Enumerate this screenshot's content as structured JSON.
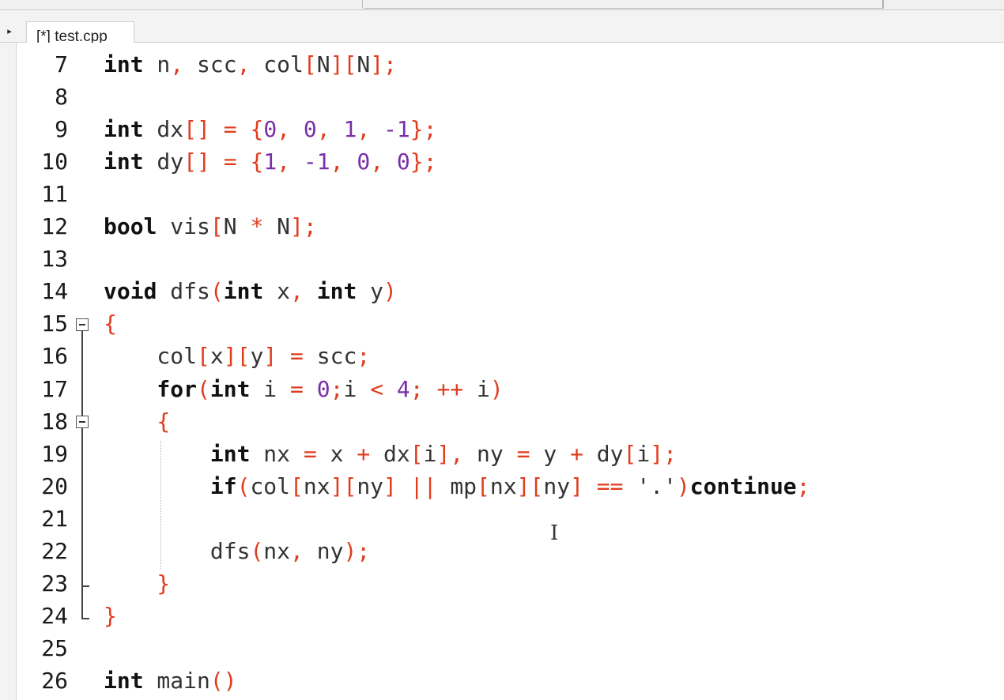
{
  "tab": {
    "label": "[*] test.cpp"
  },
  "lines": [
    {
      "num": "7",
      "tokens": [
        [
          "kw",
          "int"
        ],
        [
          "id",
          " n"
        ],
        [
          "pn",
          ","
        ],
        [
          "id",
          " scc"
        ],
        [
          "pn",
          ","
        ],
        [
          "id",
          " col"
        ],
        [
          "pn",
          "["
        ],
        [
          "id",
          "N"
        ],
        [
          "pn",
          "]["
        ],
        [
          "id",
          "N"
        ],
        [
          "pn",
          "];"
        ]
      ]
    },
    {
      "num": "8",
      "tokens": []
    },
    {
      "num": "9",
      "tokens": [
        [
          "kw",
          "int"
        ],
        [
          "id",
          " dx"
        ],
        [
          "pn",
          "[]"
        ],
        [
          "op",
          " = "
        ],
        [
          "pn",
          "{"
        ],
        [
          "num",
          "0"
        ],
        [
          "pn",
          ", "
        ],
        [
          "num",
          "0"
        ],
        [
          "pn",
          ", "
        ],
        [
          "num",
          "1"
        ],
        [
          "pn",
          ", "
        ],
        [
          "num",
          "-1"
        ],
        [
          "pn",
          "};"
        ]
      ]
    },
    {
      "num": "10",
      "tokens": [
        [
          "kw",
          "int"
        ],
        [
          "id",
          " dy"
        ],
        [
          "pn",
          "[]"
        ],
        [
          "op",
          " = "
        ],
        [
          "pn",
          "{"
        ],
        [
          "num",
          "1"
        ],
        [
          "pn",
          ", "
        ],
        [
          "num",
          "-1"
        ],
        [
          "pn",
          ", "
        ],
        [
          "num",
          "0"
        ],
        [
          "pn",
          ", "
        ],
        [
          "num",
          "0"
        ],
        [
          "pn",
          "};"
        ]
      ]
    },
    {
      "num": "11",
      "tokens": []
    },
    {
      "num": "12",
      "tokens": [
        [
          "kw",
          "bool"
        ],
        [
          "id",
          " vis"
        ],
        [
          "pn",
          "["
        ],
        [
          "id",
          "N "
        ],
        [
          "op",
          "*"
        ],
        [
          "id",
          " N"
        ],
        [
          "pn",
          "];"
        ]
      ]
    },
    {
      "num": "13",
      "tokens": []
    },
    {
      "num": "14",
      "tokens": [
        [
          "kw",
          "void"
        ],
        [
          "id",
          " dfs"
        ],
        [
          "pn",
          "("
        ],
        [
          "kw",
          "int"
        ],
        [
          "id",
          " x"
        ],
        [
          "pn",
          ", "
        ],
        [
          "kw",
          "int"
        ],
        [
          "id",
          " y"
        ],
        [
          "pn",
          ")"
        ]
      ]
    },
    {
      "num": "15",
      "tokens": [
        [
          "pn",
          "{"
        ]
      ]
    },
    {
      "num": "16",
      "tokens": [
        [
          "id",
          "    col"
        ],
        [
          "pn",
          "["
        ],
        [
          "id",
          "x"
        ],
        [
          "pn",
          "]["
        ],
        [
          "id",
          "y"
        ],
        [
          "pn",
          "]"
        ],
        [
          "op",
          " = "
        ],
        [
          "id",
          "scc"
        ],
        [
          "pn",
          ";"
        ]
      ]
    },
    {
      "num": "17",
      "tokens": [
        [
          "kw",
          "    for"
        ],
        [
          "pn",
          "("
        ],
        [
          "kw",
          "int"
        ],
        [
          "id",
          " i "
        ],
        [
          "op",
          "="
        ],
        [
          "num",
          " 0"
        ],
        [
          "pn",
          ";"
        ],
        [
          "id",
          "i "
        ],
        [
          "op",
          "<"
        ],
        [
          "num",
          " 4"
        ],
        [
          "pn",
          "; "
        ],
        [
          "op",
          "++"
        ],
        [
          "id",
          " i"
        ],
        [
          "pn",
          ")"
        ]
      ]
    },
    {
      "num": "18",
      "tokens": [
        [
          "pn",
          "    {"
        ]
      ]
    },
    {
      "num": "19",
      "tokens": [
        [
          "kw",
          "        int"
        ],
        [
          "id",
          " nx "
        ],
        [
          "op",
          "="
        ],
        [
          "id",
          " x "
        ],
        [
          "op",
          "+"
        ],
        [
          "id",
          " dx"
        ],
        [
          "pn",
          "["
        ],
        [
          "id",
          "i"
        ],
        [
          "pn",
          "], "
        ],
        [
          "id",
          "ny "
        ],
        [
          "op",
          "="
        ],
        [
          "id",
          " y "
        ],
        [
          "op",
          "+"
        ],
        [
          "id",
          " dy"
        ],
        [
          "pn",
          "["
        ],
        [
          "id",
          "i"
        ],
        [
          "pn",
          "];"
        ]
      ]
    },
    {
      "num": "20",
      "tokens": [
        [
          "kw",
          "        if"
        ],
        [
          "pn",
          "("
        ],
        [
          "id",
          "col"
        ],
        [
          "pn",
          "["
        ],
        [
          "id",
          "nx"
        ],
        [
          "pn",
          "]["
        ],
        [
          "id",
          "ny"
        ],
        [
          "pn",
          "]"
        ],
        [
          "op",
          " || "
        ],
        [
          "id",
          "mp"
        ],
        [
          "pn",
          "["
        ],
        [
          "id",
          "nx"
        ],
        [
          "pn",
          "]["
        ],
        [
          "id",
          "ny"
        ],
        [
          "pn",
          "]"
        ],
        [
          "op",
          " == "
        ],
        [
          "id",
          "'.'"
        ],
        [
          "pn",
          ")"
        ],
        [
          "kw",
          "continue"
        ],
        [
          "pn",
          ";"
        ]
      ]
    },
    {
      "num": "21",
      "tokens": []
    },
    {
      "num": "22",
      "tokens": [
        [
          "id",
          "        dfs"
        ],
        [
          "pn",
          "("
        ],
        [
          "id",
          "nx"
        ],
        [
          "pn",
          ", "
        ],
        [
          "id",
          "ny"
        ],
        [
          "pn",
          ");"
        ]
      ]
    },
    {
      "num": "23",
      "tokens": [
        [
          "pn",
          "    }"
        ]
      ]
    },
    {
      "num": "24",
      "tokens": [
        [
          "pn",
          "}"
        ]
      ]
    },
    {
      "num": "25",
      "tokens": []
    },
    {
      "num": "26",
      "tokens": [
        [
          "kw",
          "int"
        ],
        [
          "id",
          " main"
        ],
        [
          "pn",
          "()"
        ]
      ]
    }
  ],
  "cursor_glyph": "I"
}
